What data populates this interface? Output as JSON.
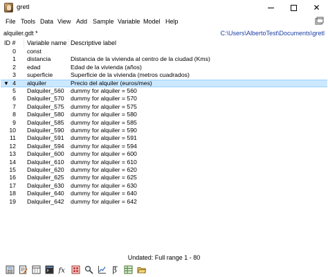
{
  "window": {
    "title": "gretl"
  },
  "menu": [
    "File",
    "Tools",
    "Data",
    "View",
    "Add",
    "Sample",
    "Variable",
    "Model",
    "Help"
  ],
  "path": {
    "filename": "alquiler.gdt *",
    "directory": "C:\\Users\\AlbertoTest\\Documents\\gretl"
  },
  "columns": {
    "id": "ID #",
    "name": "Variable name",
    "label": "Descriptive label"
  },
  "rows": [
    {
      "id": "0",
      "name": "const",
      "label": ""
    },
    {
      "id": "1",
      "name": "distancia",
      "label": "Distancia de la vivienda al centro de la ciudad (Kms)"
    },
    {
      "id": "2",
      "name": "edad",
      "label": "Edad de la vivienda (años)"
    },
    {
      "id": "3",
      "name": "superficie",
      "label": "Superficie de la vivienda (metros cuadrados)"
    },
    {
      "id": "4",
      "name": "alquiler",
      "label": "Precio del alquiler (euros/mes)"
    },
    {
      "id": "5",
      "name": "Dalquiler_560",
      "label": "dummy for alquiler = 560"
    },
    {
      "id": "6",
      "name": "Dalquiler_570",
      "label": "dummy for alquiler = 570"
    },
    {
      "id": "7",
      "name": "Dalquiler_575",
      "label": "dummy for alquiler = 575"
    },
    {
      "id": "8",
      "name": "Dalquiler_580",
      "label": "dummy for alquiler = 580"
    },
    {
      "id": "9",
      "name": "Dalquiler_585",
      "label": "dummy for alquiler = 585"
    },
    {
      "id": "10",
      "name": "Dalquiler_590",
      "label": "dummy for alquiler = 590"
    },
    {
      "id": "11",
      "name": "Dalquiler_591",
      "label": "dummy for alquiler = 591"
    },
    {
      "id": "12",
      "name": "Dalquiler_594",
      "label": "dummy for alquiler = 594"
    },
    {
      "id": "13",
      "name": "Dalquiler_600",
      "label": "dummy for alquiler = 600"
    },
    {
      "id": "14",
      "name": "Dalquiler_610",
      "label": "dummy for alquiler = 610"
    },
    {
      "id": "15",
      "name": "Dalquiler_620",
      "label": "dummy for alquiler = 620"
    },
    {
      "id": "16",
      "name": "Dalquiler_625",
      "label": "dummy for alquiler = 625"
    },
    {
      "id": "17",
      "name": "Dalquiler_630",
      "label": "dummy for alquiler = 630"
    },
    {
      "id": "18",
      "name": "Dalquiler_640",
      "label": "dummy for alquiler = 640"
    },
    {
      "id": "19",
      "name": "Dalquiler_642",
      "label": "dummy for alquiler = 642"
    }
  ],
  "selected_id": "4",
  "expander_glyph": "▼",
  "status": "Undated: Full range 1 - 80",
  "colors": {
    "selection": "#cce8ff",
    "path": "#1a3fa3"
  },
  "toolbar_icons": [
    "calculator-icon",
    "script-editor-icon",
    "new-dataset-icon",
    "console-icon",
    "function-fx-icon",
    "session-icon",
    "search-icon",
    "graph-icon",
    "beta-model-icon",
    "data-table-icon",
    "open-folder-icon"
  ]
}
